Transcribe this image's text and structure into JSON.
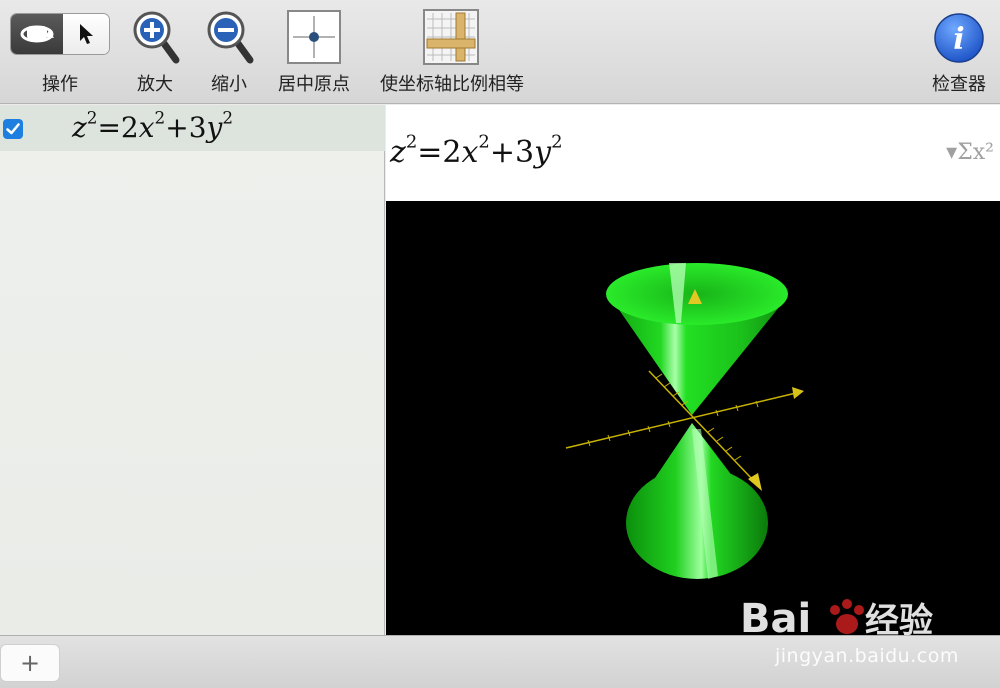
{
  "toolbar": {
    "actions_label": "操作",
    "zoom_in_label": "放大",
    "zoom_out_label": "缩小",
    "center_origin_label": "居中原点",
    "equal_scale_label": "使坐标轴比例相等",
    "inspector_label": "检查器"
  },
  "equation_list": {
    "items": [
      {
        "checked": true,
        "lhs_var": "z",
        "lhs_exp": "2",
        "op": "=",
        "c1": "2",
        "v1": "x",
        "e1": "2",
        "plus": "+",
        "c2": "3",
        "v2": "y",
        "e2": "2"
      }
    ]
  },
  "formula_bar": {
    "lhs_var": "z",
    "lhs_exp": "2",
    "op": "=",
    "c1": "2",
    "v1": "x",
    "e1": "2",
    "plus": "+",
    "c2": "3",
    "v2": "y",
    "e2": "2",
    "format_menu_label": "▾Σx²"
  },
  "bottom_bar": {
    "add_label": "+"
  },
  "watermark": {
    "text": "jingyan.baidu.com",
    "logo_label": "Bai du 经验"
  },
  "colors": {
    "surface": "#1ee61e",
    "axes": "#c8b400",
    "checkbox": "#1f7fe0",
    "inspector": "#2b6fe0"
  }
}
